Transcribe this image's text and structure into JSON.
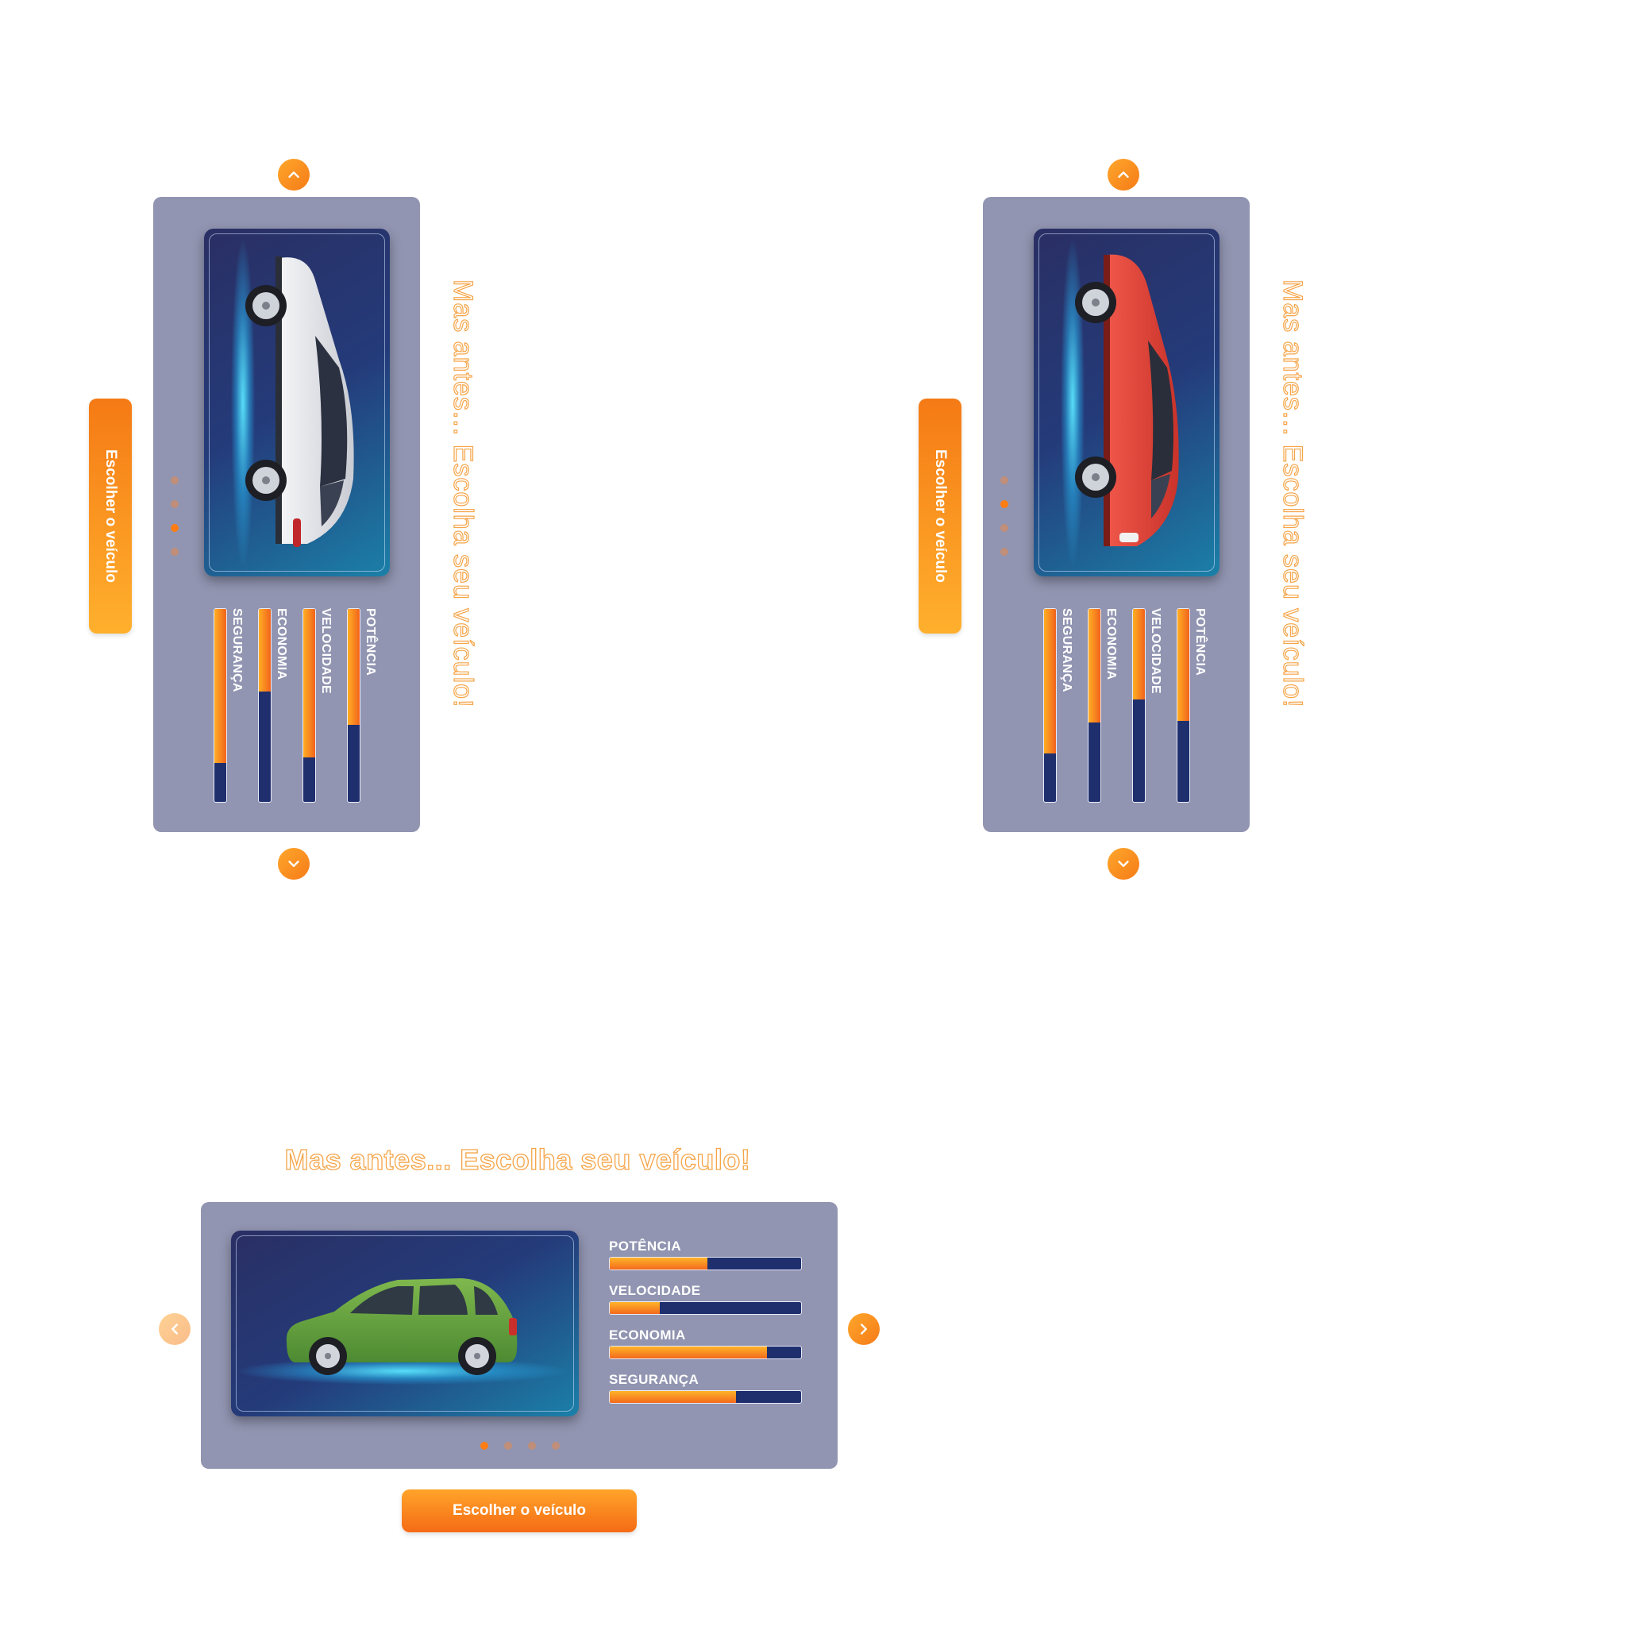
{
  "colors": {
    "accent": "#F7831C",
    "panel": "#9195B1",
    "track": "#1F2F6E",
    "headline_outline": "#F6A447"
  },
  "headline": "Mas antes... Escolha seu veículo!",
  "choose_button_label": "Escolher o veículo",
  "stat_labels": [
    "POTÊNCIA",
    "VELOCIDADE",
    "ECONOMIA",
    "SEGURANÇA"
  ],
  "icons": {
    "up": "chevron-up-icon",
    "down": "chevron-down-icon",
    "prev": "chevron-left-icon",
    "next": "chevron-right-icon"
  },
  "variants": [
    {
      "layout": "vertical",
      "car_color": "white",
      "active_dot": 3,
      "dot_count": 4,
      "stats": [
        0.6,
        0.77,
        0.43,
        0.8
      ]
    },
    {
      "layout": "vertical",
      "car_color": "red",
      "active_dot": 2,
      "dot_count": 4,
      "stats": [
        0.58,
        0.47,
        0.59,
        0.75
      ]
    },
    {
      "layout": "horizontal",
      "car_color": "green",
      "active_dot": 1,
      "dot_count": 4,
      "stats": [
        0.51,
        0.26,
        0.82,
        0.66
      ]
    }
  ]
}
